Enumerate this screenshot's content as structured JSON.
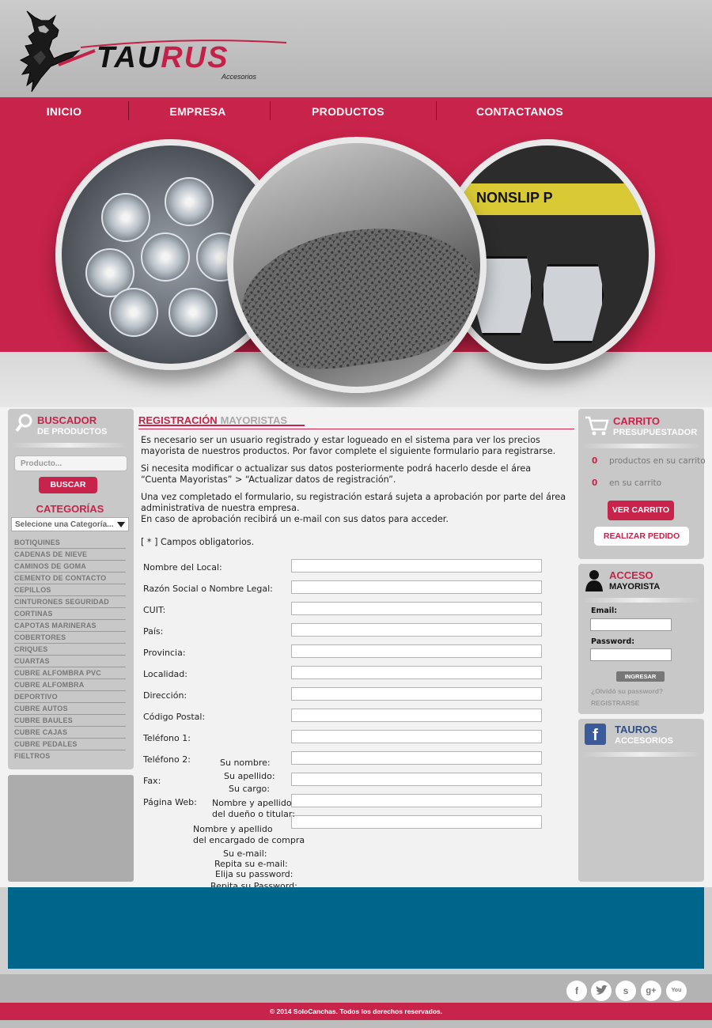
{
  "logo": {
    "name": "TAURUS",
    "subtitle": "Accesorios"
  },
  "nav": [
    "INICIO",
    "EMPRESA",
    "PRODUCTOS",
    "CONTACTANOS"
  ],
  "banner": {
    "slide3_text": "NONSLIP P"
  },
  "search_panel": {
    "title_line1": "BUSCADOR",
    "title_line2": "DE PRODUCTOS",
    "placeholder": "Producto...",
    "button": "BUSCAR",
    "categories_title": "CATEGORÍAS",
    "select_value": "Selecione una Categoría...",
    "categories": [
      "BOTIQUINES",
      "CADENAS DE NIEVE",
      "CAMINOS DE GOMA",
      "CEMENTO DE CONTACTO",
      "CEPILLOS",
      "CINTURONES SEGURIDAD",
      "CORTINAS",
      "CAPOTAS MARINERAS",
      "COBERTORES",
      "CRIQUES",
      "CUARTAS",
      "CUBRE ALFOMBRA PVC",
      "CUBRE ALFOMBRA",
      "DEPORTIVO",
      "CUBRE AUTOS",
      "CUBRE BAULES",
      "CUBRE CAJAS",
      "CUBRE PEDALES",
      "FIELTROS"
    ]
  },
  "registration": {
    "title": "REGISTRACIÓN",
    "title_suffix": "MAYORISTAS",
    "p1": "Es necesario ser un usuario registrado y estar logueado en el sistema para ver los precios mayorista de nuestros productos. Por favor complete el siguiente formulario para registrarse.",
    "p2": "Si necesita modificar o actualizar sus datos posteriormente podrá hacerlo desde el área “Cuenta Mayoristas” > “Actualizar datos de registración”.",
    "p3": "Una vez completado el formulario, su registración estará sujeta a aprobación por parte del área administrativa de nuestra empresa.",
    "p4": "En caso de aprobación recibirá un e-mail con sus datos para acceder.",
    "required_note": "[ * ] Campos obligatorios.",
    "fields": [
      "Nombre del Local:",
      "Razón Social o Nombre Legal:",
      "CUIT:",
      "País:",
      "Provincia:",
      "Localidad:",
      "Dirección:",
      "Código Postal:",
      "Teléfono 1:",
      "Teléfono 2:",
      "Fax:",
      "Página Web:"
    ],
    "overflow_labels": [
      "Su nombre:",
      "Su apellido:",
      "Su cargo:",
      "Nombre y apellido",
      "del dueño o titular:",
      "Nombre y apellido",
      "del encargado de compra",
      "Su e-mail:",
      "Repita su e-mail:",
      "Elija su password:",
      "Repita su Password:"
    ]
  },
  "cart": {
    "title_line1": "CARRITO",
    "title_line2": "PRESUPUESTADOR",
    "count": "0",
    "count_label": "productos en su carrito",
    "total": "0",
    "total_label": "en su carrito",
    "view_button": "VER CARRITO",
    "order_button": "REALIZAR PEDIDO"
  },
  "login": {
    "title_line1": "ACCESO",
    "title_line2": "MAYORISTA",
    "email_label": "Email:",
    "password_label": "Password:",
    "submit": "INGRESAR",
    "forgot": "¿Olvidó su password?",
    "register": "REGISTRARSE"
  },
  "facebook": {
    "title_line1": "TAUROS",
    "title_line2": "ACCESORIOS"
  },
  "footer": {
    "copyright": "© 2014 SoloCanchas. Todos los derechos reservados.",
    "social": [
      "f",
      "t",
      "s",
      "g+",
      "You"
    ]
  },
  "colors": {
    "accent": "#c8234a",
    "band": "#00658a"
  }
}
